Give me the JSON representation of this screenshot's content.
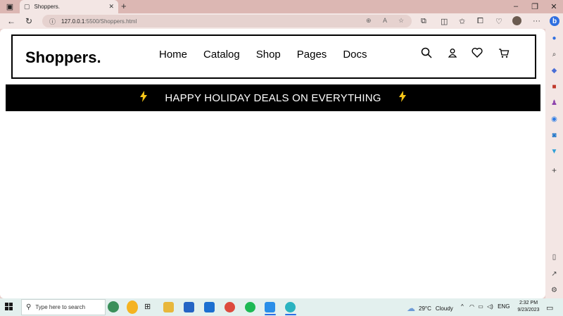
{
  "browser": {
    "tab_title": "Shoppers.",
    "tab_close": "✕",
    "new_tab": "+",
    "url_host": "127.0.0.1",
    "url_path": ":5500/Shoppers.html",
    "minimize": "–",
    "restore": "❐",
    "close": "✕",
    "more": "···"
  },
  "site": {
    "brand": "Shoppers.",
    "menu": [
      "Home",
      "Catalog",
      "Shop",
      "Pages",
      "Docs"
    ],
    "banner_text": "HAPPY HOLIDAY DEALS ON EVERYTHING"
  },
  "taskbar": {
    "search_placeholder": "Type here to search",
    "weather_temp": "29°C",
    "weather_desc": "Cloudy",
    "lang": "ENG",
    "time": "2:32 PM",
    "date": "9/23/2023"
  },
  "colors": {
    "accent_bolt": "#f5c518",
    "banner_bg": "#000000",
    "browser_chrome": "#dcb7b3"
  }
}
